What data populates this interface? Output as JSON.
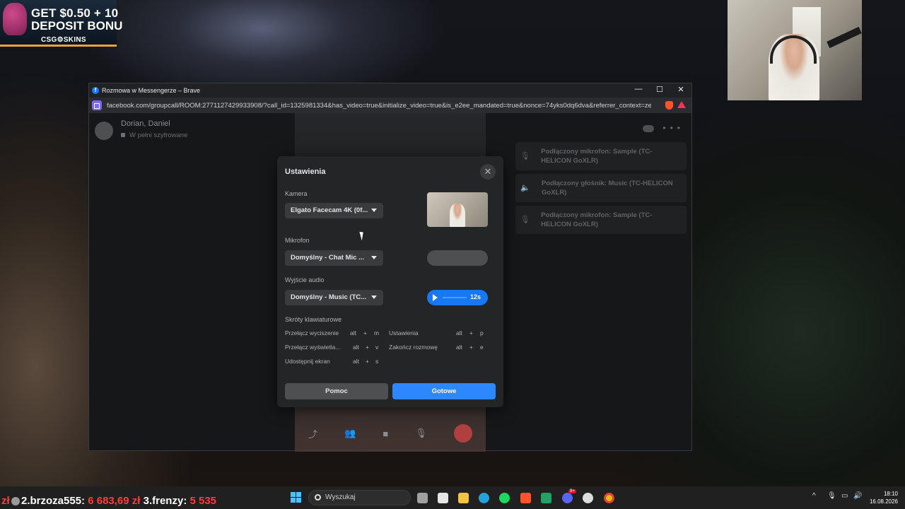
{
  "stream_ad": {
    "line1": "GET $0.50 + 10",
    "line2": "DEPOSIT BONU",
    "brand": "CSG⚙SKINS"
  },
  "browser": {
    "title": "Rozmowa w Messengerze – Brave",
    "url": "facebook.com/groupcall/ROOM:2771127429933908/?call_id=1325981334&has_video=true&initialize_video=true&is_e2ee_mandated=true&nonce=74yks0dq6dva&referrer_context=zen...",
    "minimize": "—",
    "maximize": "☐",
    "close": "✕"
  },
  "call": {
    "name": "Dorian, Daniel",
    "encryption": "W pełni szyfrowane",
    "notifications": [
      {
        "icon": "microphone-icon",
        "text": "Podłączony mikrofon: Sample (TC-HELICON GoXLR)"
      },
      {
        "icon": "speaker-icon",
        "text": "Podłączony głośnik: Music (TC-HELICON GoXLR)"
      },
      {
        "icon": "microphone-icon",
        "text": "Podłączony mikrofon: Sample (TC-HELICON GoXLR)"
      }
    ]
  },
  "settings": {
    "title": "Ustawienia",
    "close": "✕",
    "camera_label": "Kamera",
    "camera_value": "Elgato Facecam 4K (0f...",
    "mic_label": "Mikrofon",
    "mic_value": "Domyślny - Chat Mic ...",
    "audio_label": "Wyjście audio",
    "audio_value": "Domyślny - Music (TC...",
    "audio_test_time": "12s",
    "shortcuts_label": "Skróty klawiaturowe",
    "shortcuts": [
      {
        "label": "Przełącz wyciszenie",
        "keys": [
          "alt",
          "+",
          "m"
        ]
      },
      {
        "label": "Ustawienia",
        "keys": [
          "alt",
          "+",
          "p"
        ]
      },
      {
        "label": "Przełącz wyświetla...",
        "keys": [
          "alt",
          "+",
          "v"
        ]
      },
      {
        "label": "Zakończ rozmowę",
        "keys": [
          "alt",
          "+",
          "e"
        ]
      },
      {
        "label": "Udostępnij ekran",
        "keys": [
          "alt",
          "+",
          "s"
        ]
      }
    ],
    "help_button": "Pomoc",
    "done_button": "Gotowe"
  },
  "ticker": {
    "prefix": "zł",
    "text1": "2.brzoza555:",
    "amount1": "6 683,69 zł",
    "text2": "3.frenzy:",
    "amount2": "5 535"
  },
  "taskbar": {
    "search_placeholder": "Wyszukaj",
    "apps": [
      "file-explorer-icon",
      "store-icon",
      "folder-icon",
      "edge-icon",
      "spotify-icon",
      "brave-icon",
      "excel-icon",
      "discord-icon",
      "obs-icon",
      "chrome-icon"
    ],
    "discord_badge": "9+",
    "time": "18:10",
    "date": "16.08.2026",
    "accent": "#4cc2ff"
  }
}
